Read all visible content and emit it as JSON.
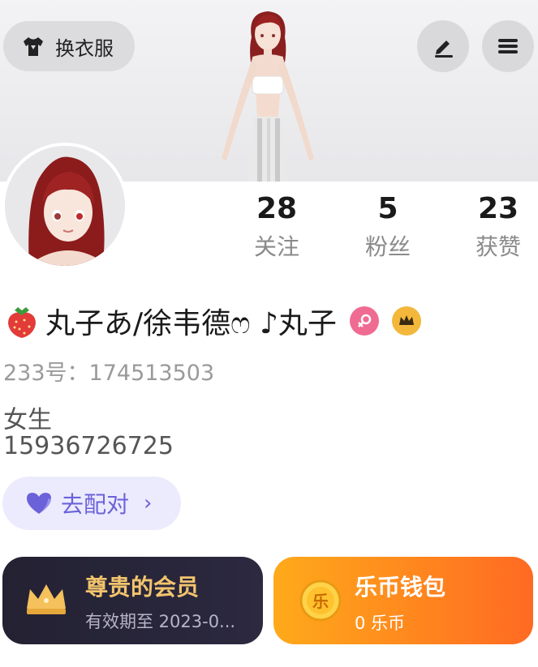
{
  "header": {
    "outfit_label": "换衣服",
    "edit_icon": "pencil-icon",
    "menu_icon": "hamburger-icon"
  },
  "stats": [
    {
      "value": "28",
      "label": "关注"
    },
    {
      "value": "5",
      "label": "粉丝"
    },
    {
      "value": "23",
      "label": "获赞"
    }
  ],
  "profile": {
    "name": "丸子あ/徐韦德ෆ ♪丸子",
    "name_prefix_icon": "strawberry-icon",
    "gender_icon": "female-icon",
    "vip_icon": "crown-icon",
    "uid": "233号：174513503",
    "bio_line1": "女生",
    "bio_line2": "15936726725"
  },
  "match": {
    "label": "去配对",
    "icon": "heart-icon"
  },
  "vip_card": {
    "title": "尊贵的会员",
    "subtitle": "有效期至 2023-0..."
  },
  "wallet_card": {
    "title": "乐币钱包",
    "subtitle": "0 乐币",
    "coin_glyph": "乐"
  },
  "colors": {
    "accent_purple": "#6b62d9",
    "gender_pink": "#f06b91",
    "vip_gold": "#f3c46d",
    "wallet_orange": "#ff8a1f"
  }
}
